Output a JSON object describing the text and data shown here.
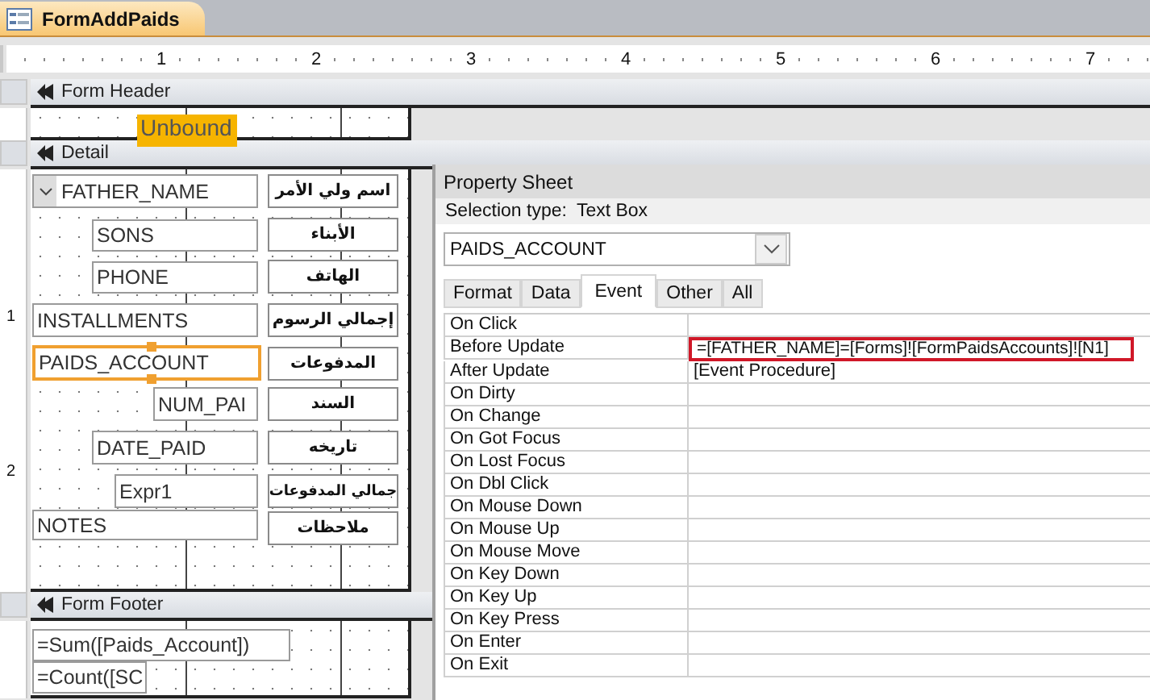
{
  "document_tab": {
    "title": "FormAddPaids",
    "selected": true
  },
  "ruler": {
    "marks": [
      "1",
      "2",
      "3",
      "4",
      "5",
      "6",
      "7"
    ]
  },
  "sections": [
    {
      "title": "Form Header",
      "kind": "header",
      "controls": [
        {
          "kind": "highlight_label",
          "text": "Unbound",
          "selected": false
        }
      ]
    },
    {
      "title": "Detail",
      "kind": "detail",
      "side_marks": [
        "1",
        "2"
      ],
      "controls": [
        {
          "kind": "combo",
          "text": "FATHER_NAME",
          "selected": false
        },
        {
          "kind": "label",
          "text": "اسم ولي الأمر",
          "selected": false
        },
        {
          "kind": "textbox",
          "text": "SONS",
          "selected": false
        },
        {
          "kind": "label",
          "text": "الأبناء",
          "selected": false
        },
        {
          "kind": "textbox",
          "text": "PHONE",
          "selected": false
        },
        {
          "kind": "label",
          "text": "الهاتف",
          "selected": false
        },
        {
          "kind": "textbox",
          "text": "INSTALLMENTS",
          "selected": false
        },
        {
          "kind": "label",
          "text": "إجمالي الرسوم",
          "selected": false
        },
        {
          "kind": "textbox",
          "text": "PAIDS_ACCOUNT",
          "selected": true
        },
        {
          "kind": "label",
          "text": "المدفوعات",
          "selected": false
        },
        {
          "kind": "textbox",
          "text": "NUM_PAI",
          "selected": false
        },
        {
          "kind": "label",
          "text": "السند",
          "selected": false
        },
        {
          "kind": "textbox",
          "text": "DATE_PAID",
          "selected": false
        },
        {
          "kind": "label",
          "text": "تاريخه",
          "selected": false
        },
        {
          "kind": "textbox",
          "text": "Expr1",
          "selected": false
        },
        {
          "kind": "label",
          "text": "جمالي المدفوعات",
          "selected": false
        },
        {
          "kind": "textbox",
          "text": "NOTES",
          "selected": false
        },
        {
          "kind": "label",
          "text": "ملاحظات",
          "selected": false
        }
      ]
    },
    {
      "title": "Form Footer",
      "kind": "footer",
      "controls": [
        {
          "kind": "textbox",
          "text": "=Sum([Paids_Account])",
          "selected": false
        },
        {
          "kind": "textbox",
          "text": "=Count([SC",
          "selected": false
        }
      ]
    }
  ],
  "property_sheet": {
    "title": "Property Sheet",
    "selection_type_label": "Selection type:",
    "selection_type": "Text Box",
    "object": "PAIDS_ACCOUNT",
    "tabs": [
      {
        "label": "Format",
        "selected": false
      },
      {
        "label": "Data",
        "selected": false
      },
      {
        "label": "Event",
        "selected": true
      },
      {
        "label": "Other",
        "selected": false
      },
      {
        "label": "All",
        "selected": false
      }
    ],
    "properties": [
      {
        "name": "On Click",
        "highlighted": false
      },
      {
        "name": "Before Update",
        "value": "=[FATHER_NAME]=[Forms]![FormPaidsAccounts]![N1]",
        "highlighted": true
      },
      {
        "name": "After Update",
        "value": "[Event Procedure]",
        "highlighted": false
      },
      {
        "name": "On Dirty",
        "highlighted": false
      },
      {
        "name": "On Change",
        "highlighted": false
      },
      {
        "name": "On Got Focus",
        "highlighted": false
      },
      {
        "name": "On Lost Focus",
        "highlighted": false
      },
      {
        "name": "On Dbl Click",
        "highlighted": false
      },
      {
        "name": "On Mouse Down",
        "highlighted": false
      },
      {
        "name": "On Mouse Up",
        "highlighted": false
      },
      {
        "name": "On Mouse Move",
        "highlighted": false
      },
      {
        "name": "On Key Down",
        "highlighted": false
      },
      {
        "name": "On Key Up",
        "highlighted": false
      },
      {
        "name": "On Key Press",
        "highlighted": false
      },
      {
        "name": "On Enter",
        "highlighted": false
      },
      {
        "name": "On Exit",
        "highlighted": false
      }
    ]
  }
}
